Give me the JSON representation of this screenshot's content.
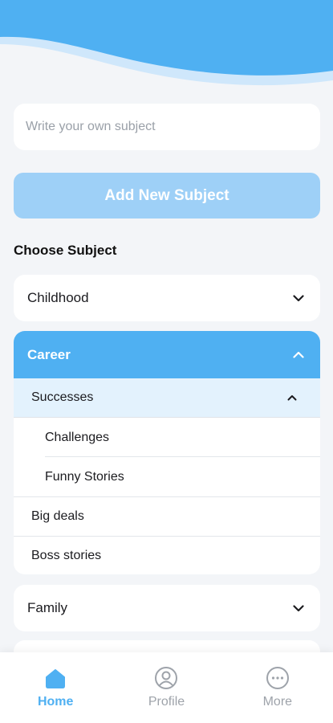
{
  "header": {
    "colors": {
      "wave_primary": "#4fb0f2",
      "wave_secondary": "#cfe7fb"
    }
  },
  "new_subject": {
    "placeholder": "Write your own subject",
    "value": "",
    "button_label": "Add New Subject"
  },
  "choose_subject": {
    "title": "Choose Subject",
    "categories": [
      {
        "label": "Childhood",
        "expanded": false,
        "icon": "chevron-down-icon"
      },
      {
        "label": "Career",
        "expanded": true,
        "icon": "chevron-up-icon",
        "subgroup": {
          "label": "Successes",
          "expanded": true,
          "icon": "chevron-up-icon",
          "items": [
            "Challenges",
            "Funny Stories"
          ]
        },
        "items": [
          "Big deals",
          "Boss stories"
        ]
      },
      {
        "label": "Family",
        "expanded": false,
        "icon": "chevron-down-icon"
      }
    ]
  },
  "tabbar": {
    "tabs": [
      {
        "label": "Home",
        "icon": "home-icon",
        "active": true
      },
      {
        "label": "Profile",
        "icon": "profile-icon",
        "active": false
      },
      {
        "label": "More",
        "icon": "more-icon",
        "active": false
      }
    ],
    "colors": {
      "active": "#4fb0f2",
      "inactive": "#9ea3aa"
    }
  }
}
